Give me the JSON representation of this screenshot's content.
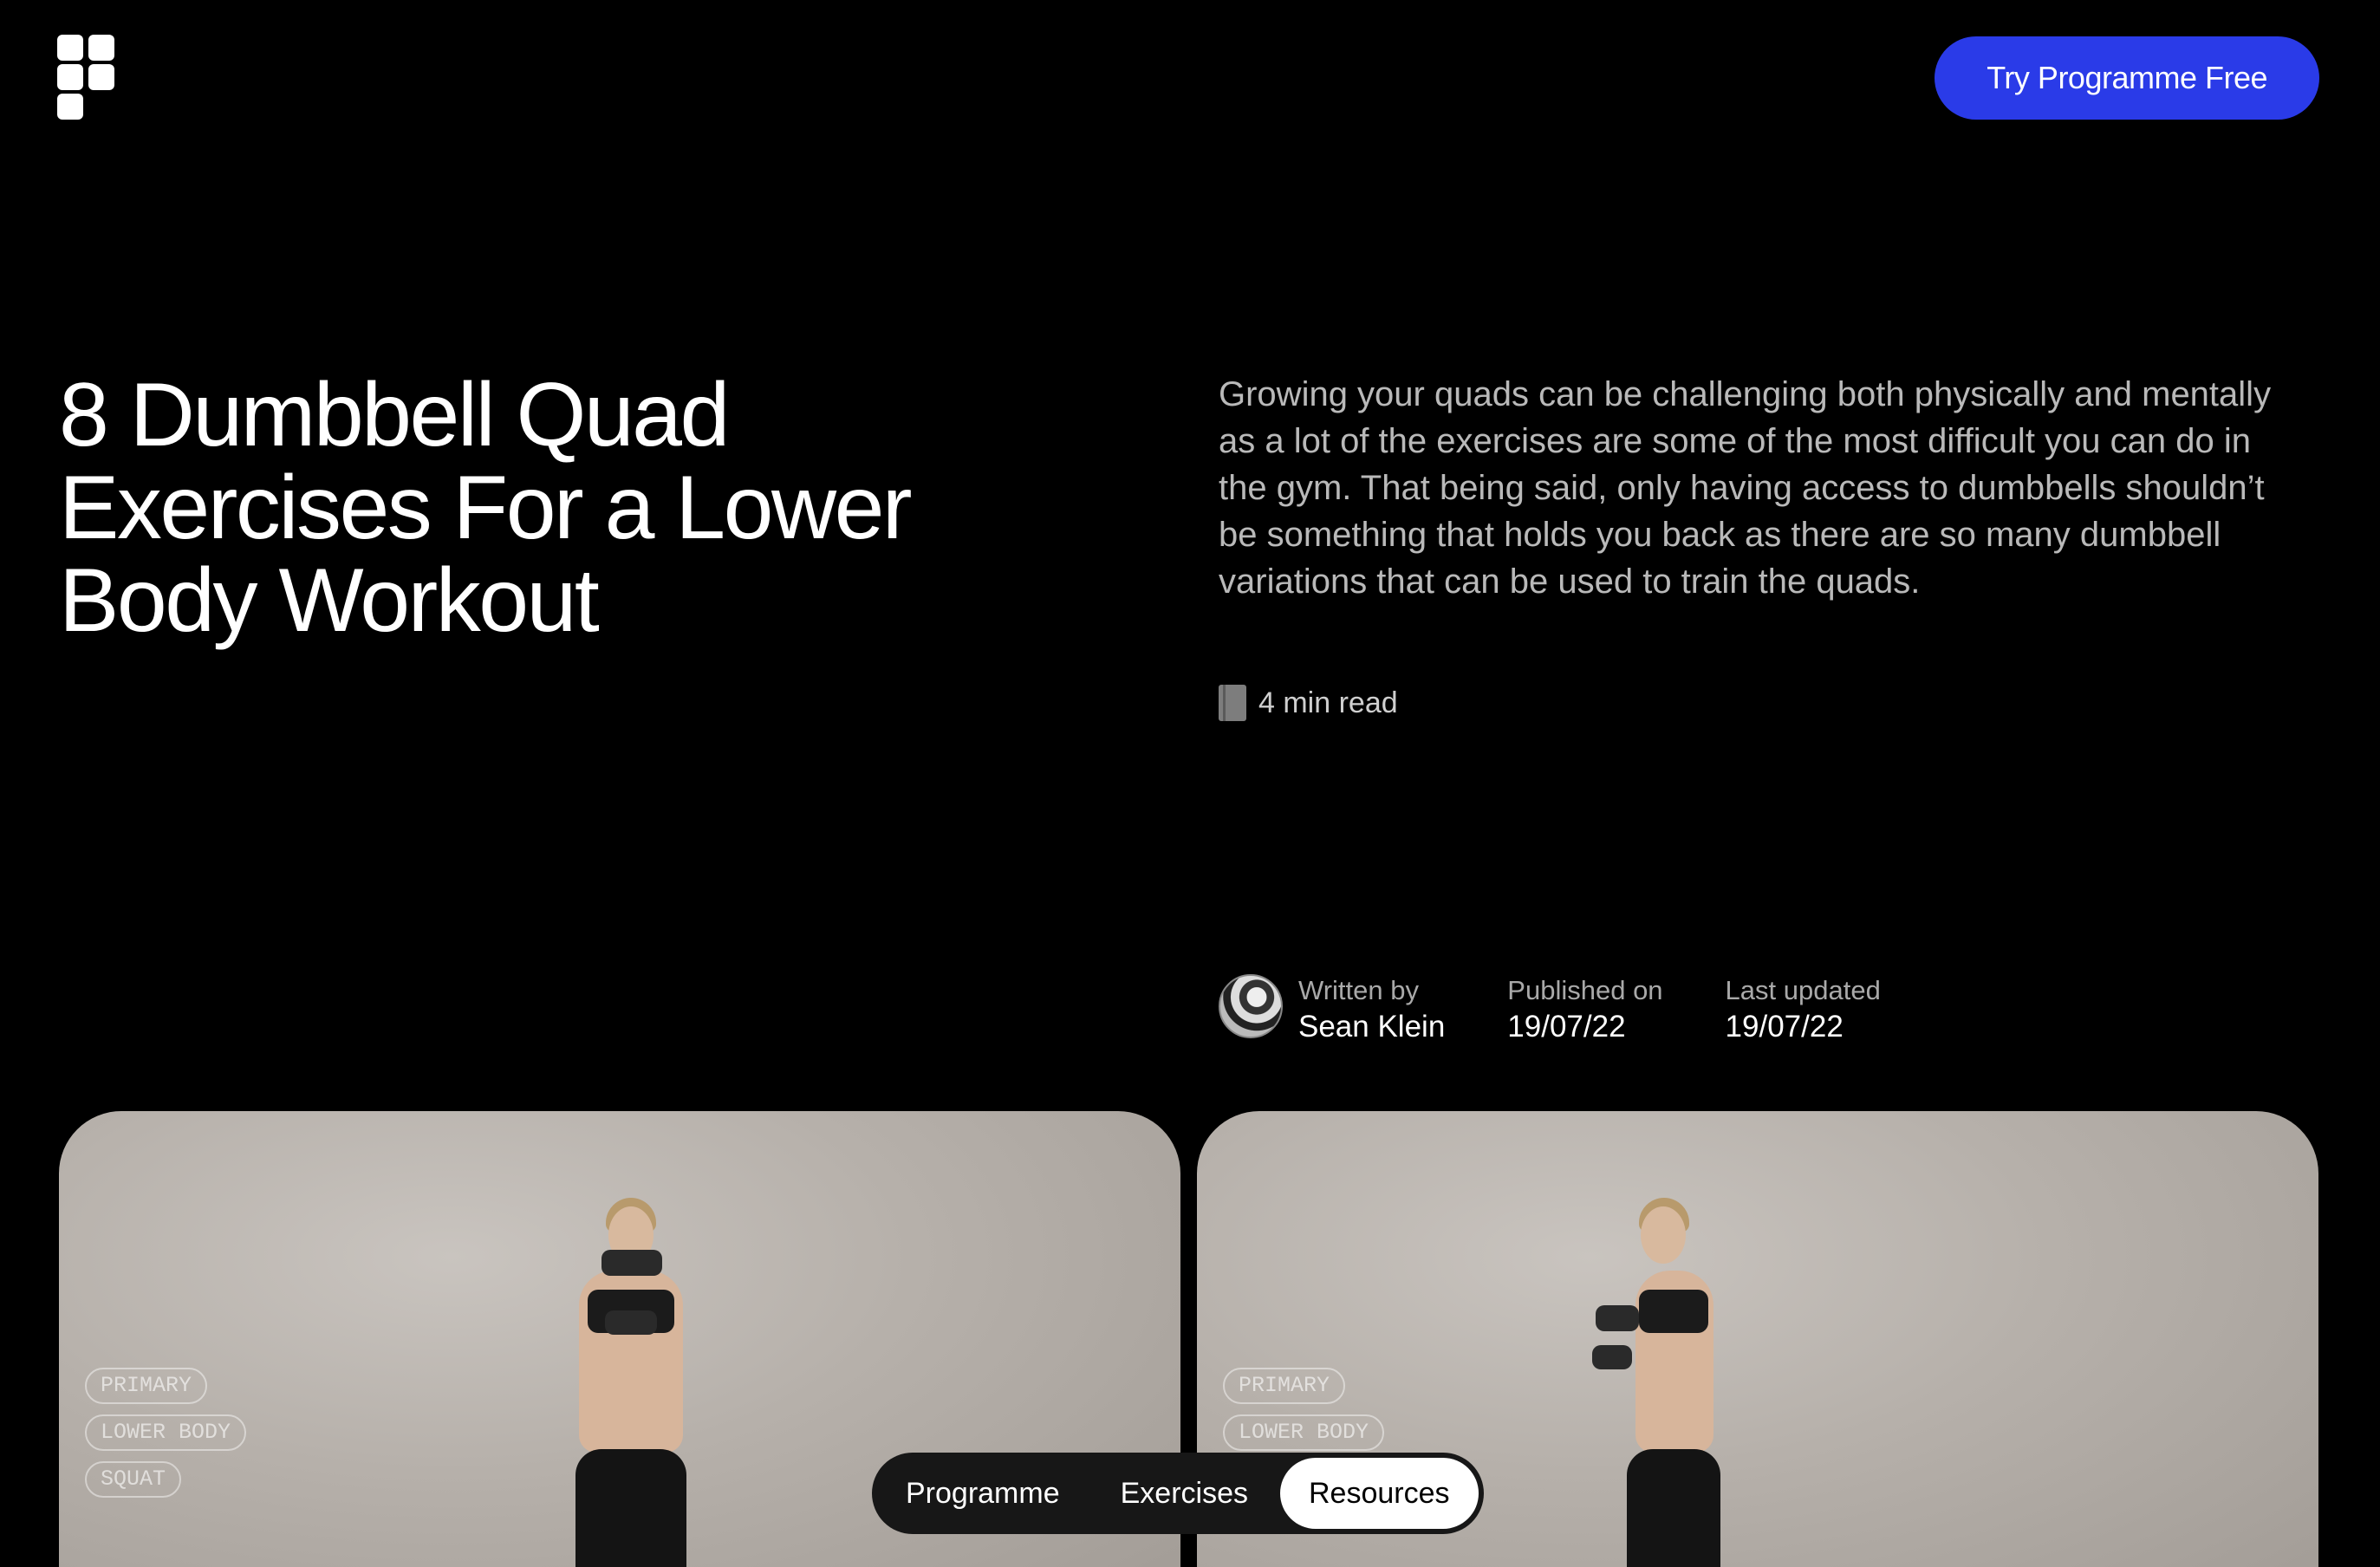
{
  "header": {
    "logo": "app-logo",
    "cta_label": "Try Programme Free",
    "accent_color": "#2a3be8"
  },
  "article": {
    "title_lines": [
      "8 Dumbbell Quad",
      "Exercises For a Lower",
      "Body Workout"
    ],
    "intro": "Growing your quads can be challenging both physically and mentally as a lot of the exercises are some of the most difficult you can do in the gym. That being said, only having access to dumbbells shouldn’t be something that holds you back as there are so many dumbbell variations that can be used to train the quads.",
    "read_time": "4 min read",
    "read_time_icon": "book-icon",
    "author_label": "Written by",
    "author_name": "Sean Klein",
    "published_label": "Published on",
    "published_date": "19/07/22",
    "updated_label": "Last updated",
    "updated_date": "19/07/22"
  },
  "cards": [
    {
      "tags": [
        "PRIMARY",
        "LOWER BODY",
        "SQUAT"
      ]
    },
    {
      "tags": [
        "PRIMARY",
        "LOWER BODY"
      ]
    }
  ],
  "bottom_nav": {
    "items": [
      "Programme",
      "Exercises",
      "Resources"
    ],
    "active": "Resources"
  }
}
